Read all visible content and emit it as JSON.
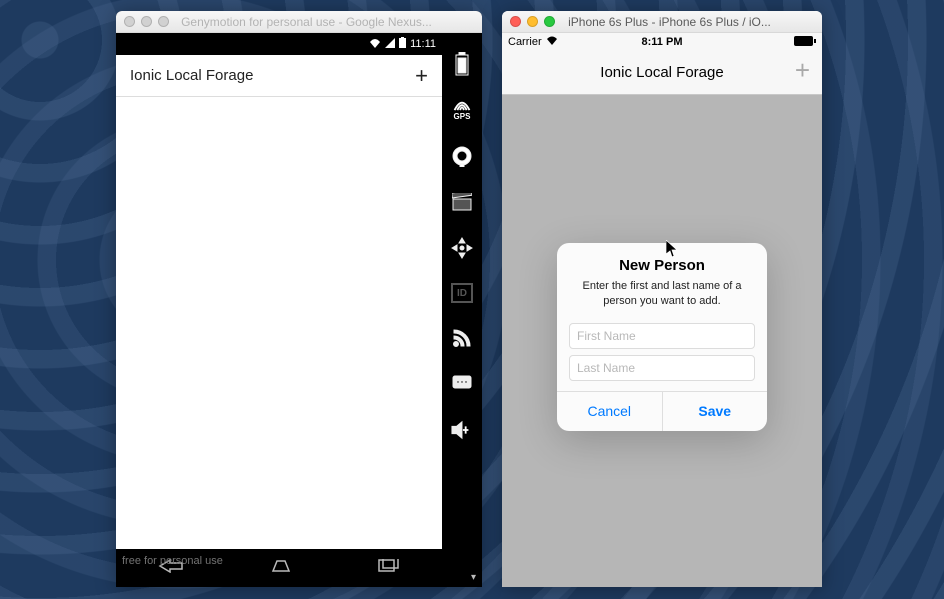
{
  "android_window": {
    "title": "Genymotion for personal use - Google Nexus...",
    "statusbar": {
      "time": "11:11"
    },
    "app": {
      "header_title": "Ionic Local Forage",
      "add_button": "+"
    },
    "watermark": "free for personal use",
    "sidebar_icons": [
      "battery-icon",
      "gps-icon",
      "camera-icon",
      "clapper-icon",
      "dpad-icon",
      "id-icon",
      "rss-icon",
      "sms-icon",
      "volume-icon"
    ],
    "gps_label": "GPS",
    "id_label": "ID"
  },
  "ios_window": {
    "title": "iPhone 6s Plus - iPhone 6s Plus / iO...",
    "statusbar": {
      "carrier": "Carrier",
      "time": "8:11 PM"
    },
    "app": {
      "header_title": "Ionic Local Forage",
      "add_button": "+"
    },
    "alert": {
      "title": "New Person",
      "message": "Enter the first and last name of a person you want to add.",
      "first_name_placeholder": "First Name",
      "last_name_placeholder": "Last Name",
      "cancel_label": "Cancel",
      "save_label": "Save"
    }
  }
}
